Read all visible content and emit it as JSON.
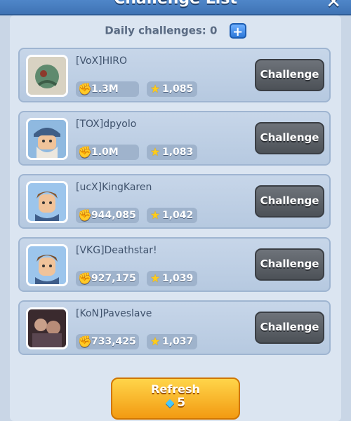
{
  "header": {
    "title": "Challenge List",
    "close_icon": "close-icon"
  },
  "daily": {
    "label": "Daily challenges: 0",
    "plus_icon": "plus-icon"
  },
  "players": [
    {
      "name": "[VoX]HIRO",
      "trophies": "1.3M",
      "stars": "1,085",
      "button": "Challenge"
    },
    {
      "name": "[TOX]dpyolo",
      "trophies": "1.0M",
      "stars": "1,083",
      "button": "Challenge"
    },
    {
      "name": "[ucX]KingKaren",
      "trophies": "944,085",
      "stars": "1,042",
      "button": "Challenge"
    },
    {
      "name": "[VKG]Deathstar!",
      "trophies": "927,175",
      "stars": "1,039",
      "button": "Challenge"
    },
    {
      "name": "[KoN]Paveslave",
      "trophies": "733,425",
      "stars": "1,037",
      "button": "Challenge"
    }
  ],
  "refresh": {
    "label": "Refresh",
    "cost": "5",
    "gem_icon": "diamond-icon"
  },
  "colors": {
    "header": "#4f86c9",
    "refresh": "#f5a623",
    "challenge_btn": "#5d6268"
  }
}
